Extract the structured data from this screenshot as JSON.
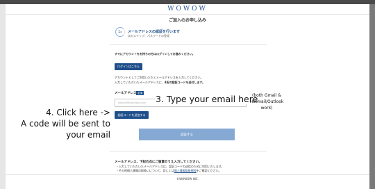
{
  "header": {
    "logo": "WOWOW",
    "title": "ご加入のお申し込み"
  },
  "step": {
    "number": "1",
    "total": "/4",
    "title": "メールアドレスの認証を行います",
    "subtitle": "次のステップ：パスワードの登録"
  },
  "login": {
    "prompt": "すでにアカウントをお持ちの方はログインしてお進みください。",
    "button_label": "ログインはこちら"
  },
  "instructions": {
    "line1": "アカウントとしてご利用いただくメールアドレスを入力してください。",
    "line2_prefix": "入力していただいたメールアドレスに、",
    "line2_bold": "4桁の認証コードを送付します。"
  },
  "email": {
    "label": "メールアドレス",
    "required": "必須",
    "placeholder": "sample@example.com",
    "send_button_label": "認証コードを送信する"
  },
  "submit": {
    "label": "認証する"
  },
  "annotations": {
    "type_email": "3. Type your email here",
    "note": "(both Gmail & Hotmail/Outlook work)",
    "click_line1": "4. Click here ->",
    "click_line2": "A code will be sent to",
    "click_line3": "your email"
  },
  "footer": {
    "heading": "メールアドレス、下記の点にご留意のうえ入力してください。",
    "bullet1": "・入力していただいたメールアドレスは、認証コードの送信のために利用いたします。",
    "bullet2_prefix": "・その他個人情報の取扱いについて、詳しくは",
    "bullet2_link": "個人情報取扱規程",
    "bullet2_suffix": "をご確認ください。",
    "copyright": "©WOWOW INC."
  }
}
